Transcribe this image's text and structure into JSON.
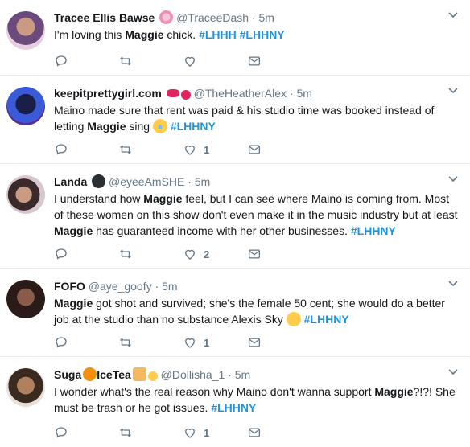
{
  "tweets": [
    {
      "name": "Tracee Ellis Bawse",
      "name_emoji": "flower-crown-emoji",
      "handle": "@TraceeDash",
      "dot": "·",
      "time": "5m",
      "text_pre": "I'm loving this ",
      "text_bold": "Maggie",
      "text_post": " chick. ",
      "hashtags": "#LHHH #LHHNY",
      "like_count": "",
      "avatar_color": "#6b4a7d"
    },
    {
      "name": "keepitprettygirl.com",
      "name_emoji": "lips-heart-emoji",
      "handle": "@TheHeatherAlex",
      "dot": "·",
      "time": "5m",
      "line1_pre": "Maino made sure that rent was paid & his studio time was booked instead of",
      "line2_pre": "letting ",
      "text_bold": "Maggie",
      "line2_post": " sing ",
      "inline_emoji": "crying-face-emoji",
      "hashtags": "#LHHNY",
      "like_count": "1",
      "avatar_color": "#2a3d8f"
    },
    {
      "name": "Landa",
      "name_emoji": "black-heart-emoji",
      "handle": "@eyeeAmSHE",
      "dot": "·",
      "time": "5m",
      "line1_pre": "I understand how ",
      "line1_bold": "Maggie",
      "line1_post": " feel, but I can see where Maino is coming from. Most",
      "line2": "of these women on this show don't even make it in the music industry but at least",
      "line3_bold": "Maggie",
      "line3_post": " has guaranteed income with her other businesses.  ",
      "hashtags": "#LHHNY",
      "like_count": "2",
      "avatar_color": "#8a6a6a"
    },
    {
      "name": "FOFO",
      "handle": "@aye_goofy",
      "dot": "·",
      "time": "5m",
      "line1_bold": "Maggie",
      "line1_post": " got shot and survived; she's the female 50 cent; she would do a better",
      "line2_pre": "job at the studio than no substance Alexis Sky ",
      "inline_emoji": "face-with-raised-eyebrow-emoji",
      "hashtags": "#LHHNY",
      "like_count": "1",
      "avatar_color": "#3a2a28"
    },
    {
      "name_part1": "Suga",
      "name_part2": "IceTea",
      "name_emoji": "honey-pot-emoji",
      "name_emoji2": "tropical-drink-sparkles-emoji",
      "handle": "@Dollisha_1",
      "dot": "·",
      "time": "5m",
      "line1_pre": "I wonder what's the real reason why Maino don't wanna support ",
      "line1_bold": "Maggie",
      "line1_post": "?!?! She",
      "line2_pre": "must be trash or he got issues. ",
      "hashtags": "#LHHNY",
      "like_count": "1",
      "avatar_color": "#7a5a3a"
    }
  ],
  "icons": {
    "reply": "reply-icon",
    "retweet": "retweet-icon",
    "like": "heart-icon",
    "message": "direct-message-icon",
    "more": "chevron-down-icon"
  },
  "colors": {
    "hashtag": "#1b95e0",
    "secondary": "#657786",
    "divider": "#e6ecf0"
  }
}
